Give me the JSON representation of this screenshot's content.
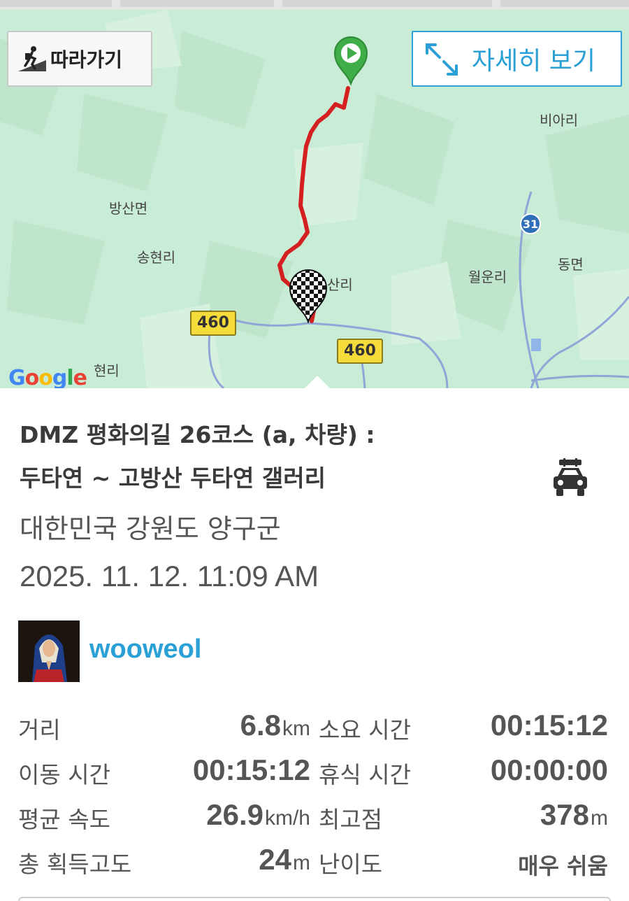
{
  "map": {
    "follow_button": {
      "label": "따라가기",
      "icon": "hiker-icon"
    },
    "detail_button": {
      "label": "자세히 보기",
      "icon": "expand-arrows-icon"
    },
    "place_labels": [
      "비아리",
      "방산면",
      "송현리",
      "산리",
      "월운리",
      "동면",
      "현리"
    ],
    "road_signs": [
      "460",
      "460"
    ],
    "route_marker": "31",
    "google_logo": "Google",
    "colors": {
      "route": "#d42020",
      "start_pin": "#3fae48",
      "road_sign": "#f5dc3a",
      "map_bg": "#c9ecd6"
    }
  },
  "course": {
    "title_line1": "DMZ 평화의길 26코스 (a, 차량) :",
    "title_line2": "두타연 ~ 고방산 두타연 갤러리",
    "transport_icon": "car-icon",
    "location": "대한민국 강원도 양구군",
    "datetime": "2025. 11. 12. 11:09 AM"
  },
  "user": {
    "name": "wooweol",
    "avatar": "avatar-image"
  },
  "stats": {
    "distance": {
      "label": "거리",
      "value": "6.8",
      "unit": "km"
    },
    "duration": {
      "label": "소요 시간",
      "value": "00:15:12"
    },
    "moving_time": {
      "label": "이동 시간",
      "value": "00:15:12"
    },
    "rest_time": {
      "label": "휴식 시간",
      "value": "00:00:00"
    },
    "avg_speed": {
      "label": "평균 속도",
      "value": "26.9",
      "unit": "km/h"
    },
    "max_altitude": {
      "label": "최고점",
      "value": "378",
      "unit": "m"
    },
    "total_gain": {
      "label": "총 획득고도",
      "value": "24",
      "unit": "m"
    },
    "difficulty": {
      "label": "난이도",
      "value": "매우 쉬움"
    }
  }
}
